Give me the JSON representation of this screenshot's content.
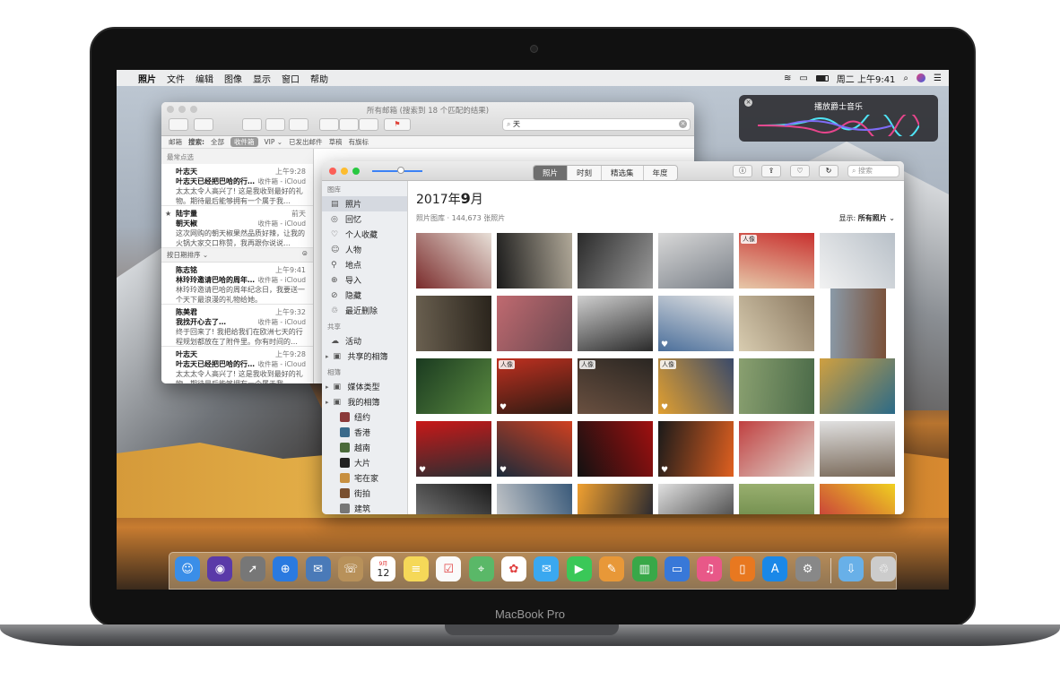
{
  "menubar": {
    "apple": "",
    "app": "照片",
    "items": [
      "文件",
      "编辑",
      "图像",
      "显示",
      "窗口",
      "帮助"
    ],
    "clock": "周二 上午9:41"
  },
  "siri": {
    "title": "播放爵士音乐"
  },
  "mail": {
    "window_title": "所有邮箱 (搜索到 18 个匹配的结果)",
    "search_value": "天",
    "filter": {
      "mailbox_label": "邮箱",
      "search_label": "搜索:",
      "scopes": [
        "全部",
        "收件箱",
        "VIP",
        "已发出邮件",
        "草稿",
        "有旗标"
      ],
      "vip_arrow": "⌄"
    },
    "top_hits_label": "最常点选",
    "sort_label": "按日期排序",
    "messages": [
      {
        "from": "叶志天",
        "time": "上午9:28",
        "subject": "叶志天已经把巴哈的行…",
        "folder": "收件箱 - iCloud",
        "preview": "太太太令人高兴了! 这是我收到最好的礼物。期待最后能够拥有一个属于我…"
      },
      {
        "from": "陆宇量",
        "time": "前天",
        "subject": "朝天椒",
        "folder": "收件箱 - iCloud",
        "preview": "这次网购的朝天椒果然品质好辣，让我的火锅大家交口称赞，我再跟你说说…",
        "star": "★"
      },
      {
        "from": "陈志铭",
        "time": "上午9:41",
        "subject": "林玲玲邀请巴哈的周年…",
        "folder": "收件箱 - iCloud",
        "preview": "林玲玲邀请巴哈的周年纪念日，我要送一个天下最浪漫的礼物给她。"
      },
      {
        "from": "陈美君",
        "time": "上午9:32",
        "subject": "我找开心去了…",
        "folder": "收件箱 - iCloud",
        "preview": "终于回来了! 我把给我们在欧洲七天的行程规划都放在了附件里。你有时间的…"
      },
      {
        "from": "叶志天",
        "time": "上午9:28",
        "subject": "叶志天已经把巴哈的行…",
        "folder": "收件箱 - iCloud",
        "preview": "太太太令人高兴了! 这是我收到最好的礼物。期待最后能够拥有一个属于我…"
      }
    ]
  },
  "photos": {
    "tabs": [
      "照片",
      "时刻",
      "精选集",
      "年度"
    ],
    "search_placeholder": "搜索",
    "title_prefix": "2017年",
    "title_month": "9",
    "title_suffix": "月",
    "subtitle": "照片图库 · 144,673 张照片",
    "show_label": "显示:",
    "show_value": "所有照片",
    "sidebar": {
      "library_head": "图库",
      "library": [
        {
          "label": "照片",
          "icon": "photos-grid-icon",
          "glyph": "▤"
        },
        {
          "label": "回忆",
          "icon": "memories-icon",
          "glyph": "◎"
        },
        {
          "label": "个人收藏",
          "icon": "heart-icon",
          "glyph": "♡"
        },
        {
          "label": "人物",
          "icon": "people-icon",
          "glyph": "☺"
        },
        {
          "label": "地点",
          "icon": "pin-icon",
          "glyph": "⚲"
        },
        {
          "label": "导入",
          "icon": "import-icon",
          "glyph": "⊕"
        },
        {
          "label": "隐藏",
          "icon": "hidden-icon",
          "glyph": "⊘"
        },
        {
          "label": "最近删除",
          "icon": "trash-icon",
          "glyph": "♲"
        }
      ],
      "shared_head": "共享",
      "shared": [
        {
          "label": "活动",
          "icon": "cloud-icon",
          "glyph": "☁"
        },
        {
          "label": "共享的相簿",
          "icon": "shared-album-icon",
          "glyph": "▣"
        }
      ],
      "albums_head": "相簿",
      "albums": [
        {
          "label": "媒体类型",
          "icon": "folder-icon",
          "glyph": "▣"
        },
        {
          "label": "我的相簿",
          "icon": "folder-icon",
          "glyph": "▣"
        }
      ],
      "my_albums": [
        "纽约",
        "香港",
        "越南",
        "大片",
        "宅在家",
        "街拍",
        "建筑"
      ]
    },
    "grid_labels": {
      "person": "人像",
      "heart": "♥"
    }
  },
  "dock": {
    "calendar_month": "9月",
    "calendar_day": "12"
  },
  "device": {
    "brand": "MacBook Pro"
  }
}
